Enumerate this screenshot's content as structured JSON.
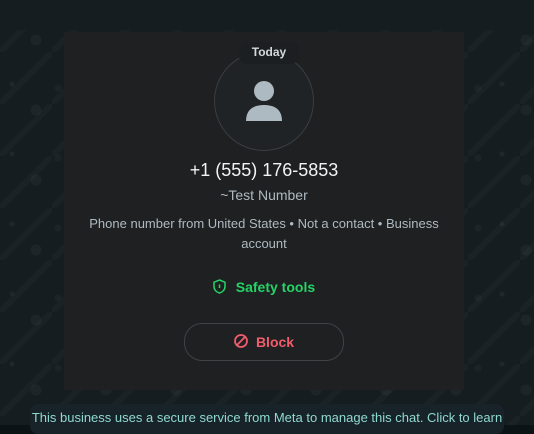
{
  "chat": {
    "date_separator": "Today",
    "contact": {
      "phone": "+1 (555) 176-5853",
      "name": "~Test Number",
      "info": "Phone number from United States • Not a contact • Business account",
      "safety_label": "Safety tools",
      "block_label": "Block"
    },
    "notice": "This business uses a secure service from Meta to manage this chat. Click to learn"
  },
  "icons": {
    "avatar": "default-user-avatar-icon",
    "safety": "shield-icon",
    "block": "block-icon"
  },
  "colors": {
    "accent_green": "#25d366",
    "danger_red": "#f15c6d",
    "notice_text": "#8fd9d0"
  }
}
